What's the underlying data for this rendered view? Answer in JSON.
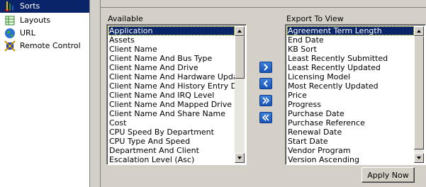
{
  "tree": {
    "items": [
      {
        "label": "Sorts",
        "icon": "sort-icon",
        "selected": true
      },
      {
        "label": "Layouts",
        "icon": "layouts-icon",
        "selected": false
      },
      {
        "label": "URL",
        "icon": "globe-icon",
        "selected": false
      },
      {
        "label": "Remote Control",
        "icon": "remote-control-icon",
        "selected": false
      }
    ]
  },
  "available": {
    "label": "Available",
    "items": [
      "Application",
      "Assets",
      "Client Name",
      "Client Name And Bus Type",
      "Client Name And Drive",
      "Client Name And Hardware Update Date",
      "Client Name And History Entry Date",
      "Client Name And IRQ Level",
      "Client Name And Mapped Drive Letter",
      "Client Name And Share Name",
      "Cost",
      "CPU Speed By Department",
      "CPU Type And Speed",
      "Department And Client",
      "Escalation Level (Asc)"
    ],
    "selected_index": 0
  },
  "export": {
    "label": "Export To View",
    "items": [
      "Agreement Term Length",
      "End Date",
      "KB Sort",
      "Least Recently Submitted",
      "Least Recently Updated",
      "Licensing Model",
      "Most Recently Updated",
      "Price",
      "Progress",
      "Purchase Date",
      "Purchase Reference",
      "Renewal Date",
      "Start Date",
      "Vendor Program",
      "Version Ascending"
    ],
    "selected_index": 0
  },
  "buttons": {
    "move_right": "move-right-icon",
    "move_left": "move-left-icon",
    "move_all_right": "move-all-right-icon",
    "move_all_left": "move-all-left-icon",
    "apply_label": "Apply Now"
  },
  "colors": {
    "selection": "#0a246a",
    "face": "#d4d0c8",
    "button_blue": "#1a54b8"
  }
}
